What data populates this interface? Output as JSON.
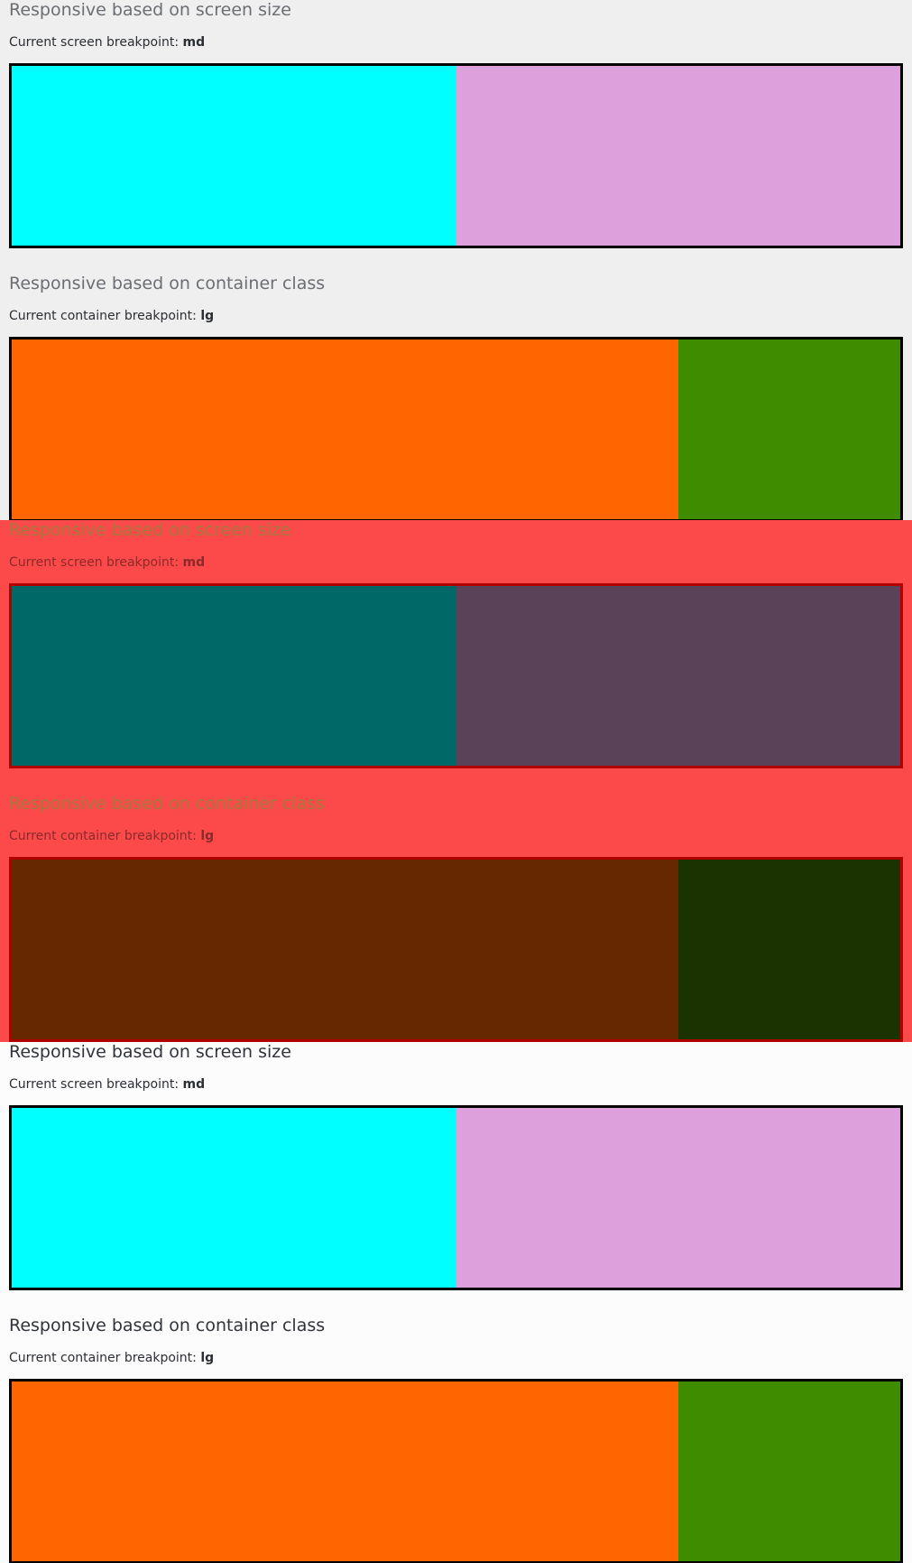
{
  "panels": [
    {
      "screen_section": {
        "title": "Responsive based on screen size",
        "label": "Current screen breakpoint:",
        "value": "md",
        "colors": [
          "#00ffff",
          "#dda0dd"
        ]
      },
      "container_section": {
        "title": "Responsive based on container class",
        "label": "Current container breakpoint:",
        "value": "lg",
        "colors": [
          "#ff6600",
          "#408c00"
        ]
      }
    },
    {
      "screen_section": {
        "title": "Responsive based on screen size",
        "label": "Current screen breakpoint:",
        "value": "md",
        "colors": [
          "#006866",
          "#5a4358"
        ]
      },
      "container_section": {
        "title": "Responsive based on container class",
        "label": "Current container breakpoint:",
        "value": "lg",
        "colors": [
          "#662800",
          "#1a3300"
        ]
      }
    },
    {
      "screen_section": {
        "title": "Responsive based on screen size",
        "label": "Current screen breakpoint:",
        "value": "md",
        "colors": [
          "#00ffff",
          "#dda0dd"
        ]
      },
      "container_section": {
        "title": "Responsive based on container class",
        "label": "Current container breakpoint:",
        "value": "lg",
        "colors": [
          "#ff6600",
          "#408c00"
        ]
      }
    }
  ]
}
